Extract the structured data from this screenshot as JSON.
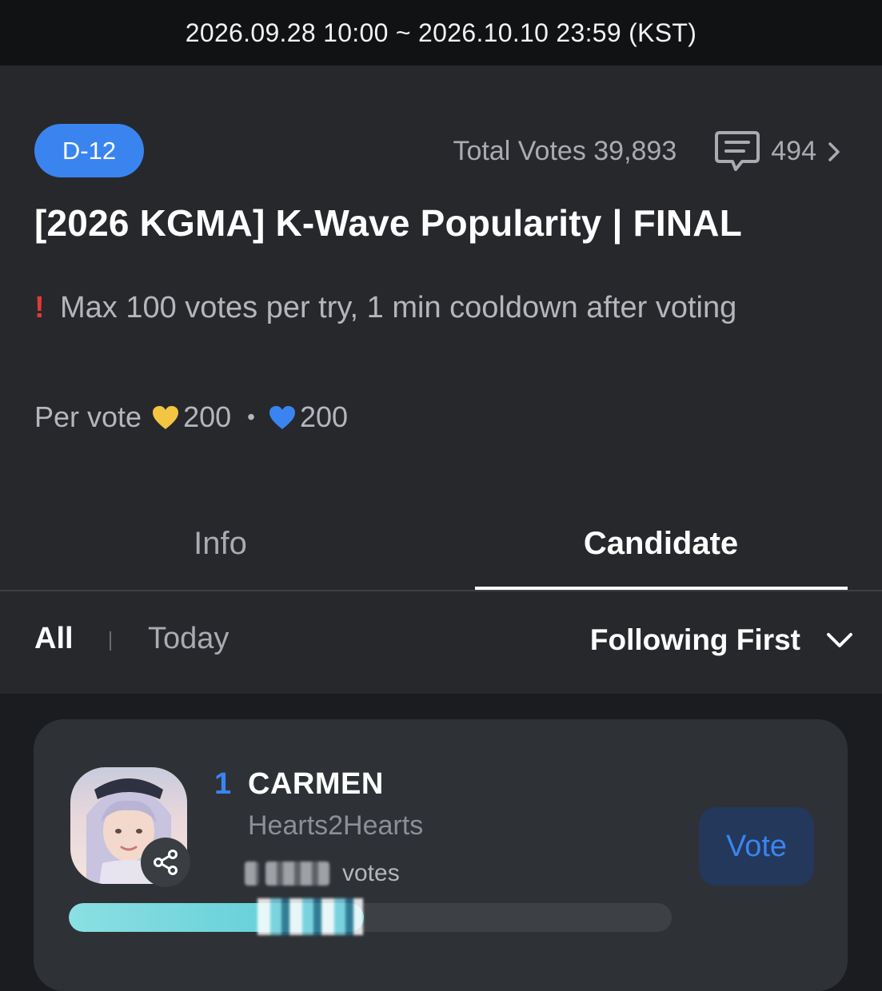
{
  "header": {
    "period": "2026.09.28 10:00 ~ 2026.10.10 23:59 (KST)"
  },
  "event": {
    "dday_badge": "D-12",
    "total_votes_label": "Total Votes 39,893",
    "comment_count": "494",
    "title": "[2026 KGMA] K-Wave Popularity | FINAL",
    "notice_icon": "!",
    "notice_text": "Max 100 votes per try, 1 min cooldown after voting",
    "per_vote_label": "Per vote",
    "gold_heart_cost": "200",
    "separator": "•",
    "blue_heart_cost": "200"
  },
  "tabs": [
    {
      "label": "Info",
      "active": false
    },
    {
      "label": "Candidate",
      "active": true
    }
  ],
  "filters": {
    "all_label": "All",
    "today_label": "Today",
    "sort_label": "Following First"
  },
  "candidates": [
    {
      "rank": "1",
      "name": "CARMEN",
      "group": "Hearts2Hearts",
      "votes_suffix": "votes",
      "vote_button": "Vote",
      "progress_fraction": 0.49
    }
  ],
  "colors": {
    "accent_blue": "#3a84f0",
    "gold_heart": "#f4c542",
    "blue_heart": "#3a84f0",
    "notice_red": "#e53935",
    "progress": "#6fd3dc"
  },
  "icons": [
    "comment-icon",
    "chevron-right-icon",
    "gold-heart-icon",
    "blue-heart-icon",
    "chevron-down-icon",
    "share-icon"
  ]
}
